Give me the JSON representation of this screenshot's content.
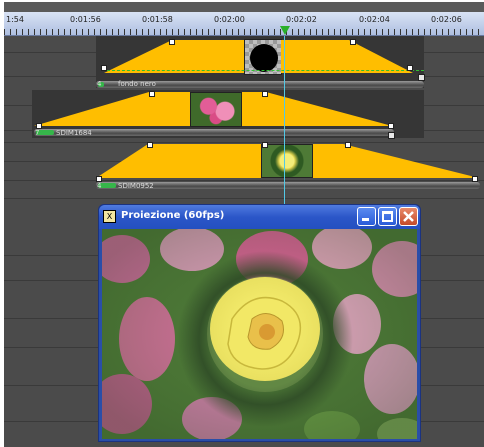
{
  "ruler": {
    "labels": [
      "1:54",
      "0:01:56",
      "0:01:58",
      "0:02:00",
      "0:02:02",
      "0:02:04",
      "0:02:06"
    ]
  },
  "tracks": [
    {
      "clip_name": "fondo nero",
      "marker": "4"
    },
    {
      "clip_name": "SDIM1684",
      "marker": "7"
    },
    {
      "clip_name": "SDIM0952",
      "marker": "4"
    }
  ],
  "preview": {
    "title": "Proiezione (60fps)",
    "icon_glyph": "X",
    "buttons": {
      "minimize": "minimize-button",
      "maximize": "maximize-button",
      "close": "close-button"
    }
  },
  "colors": {
    "transition": "#ffbe00",
    "clip_indicator": "#36b64a",
    "playhead": "#2ab02a",
    "window_title": "#2b56c8"
  }
}
